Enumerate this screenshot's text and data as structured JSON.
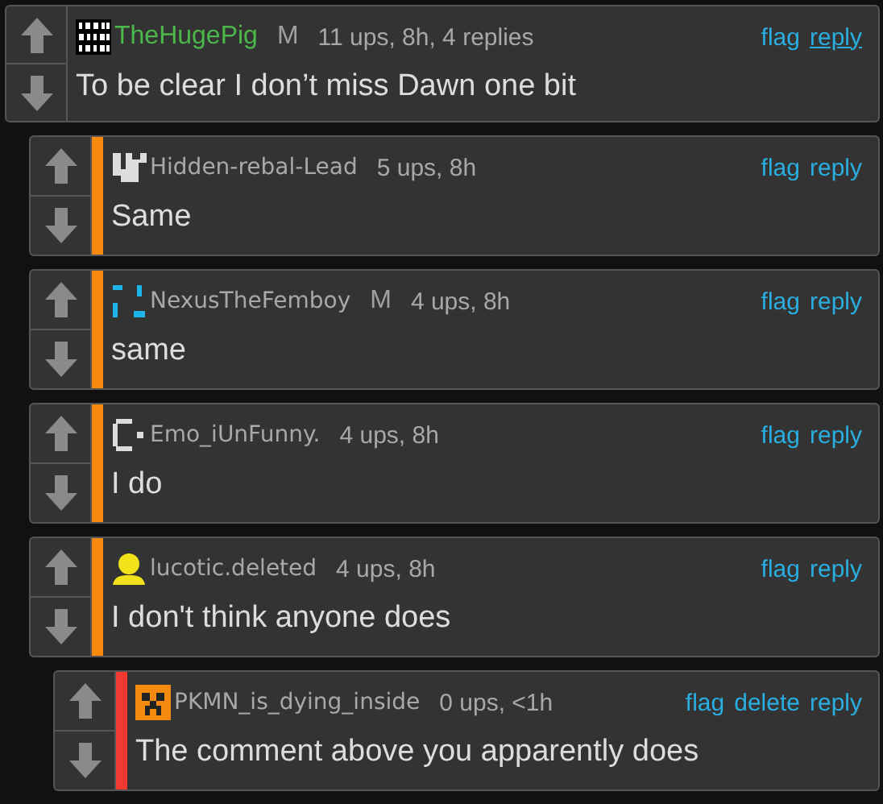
{
  "comments": [
    {
      "username": "TheHugePig",
      "name_highlighted": true,
      "badge": "M",
      "meta": "11 ups, 8h, 4 replies",
      "actions": [
        {
          "label": "flag",
          "underlined": false
        },
        {
          "label": "reply",
          "underlined": true
        }
      ],
      "text": "To be clear I don’t miss Dawn one bit",
      "children": [
        {
          "username": "Hidden-rebal-Lead",
          "name_highlighted": false,
          "color": "#f78a0e",
          "meta": "5 ups, 8h",
          "actions": [
            {
              "label": "flag",
              "underlined": false
            },
            {
              "label": "reply",
              "underlined": false
            }
          ],
          "text": "Same"
        },
        {
          "username": "NexusTheFemboy",
          "name_highlighted": false,
          "color": "#f78a0e",
          "badge": "M",
          "meta": "4 ups, 8h",
          "actions": [
            {
              "label": "flag",
              "underlined": false
            },
            {
              "label": "reply",
              "underlined": false
            }
          ],
          "text": "same"
        },
        {
          "username": "Emo_iUnFunny.",
          "name_highlighted": false,
          "color": "#f78a0e",
          "meta": "4 ups, 8h",
          "actions": [
            {
              "label": "flag",
              "underlined": false
            },
            {
              "label": "reply",
              "underlined": false
            }
          ],
          "text": "I do"
        },
        {
          "username": "lucotic.deleted",
          "name_highlighted": false,
          "color": "#f78a0e",
          "meta": "4 ups, 8h",
          "actions": [
            {
              "label": "flag",
              "underlined": false
            },
            {
              "label": "reply",
              "underlined": false
            }
          ],
          "text": "I don't think anyone does",
          "children": [
            {
              "username": "PKMN_is_dying_inside",
              "name_highlighted": false,
              "color": "#f23a32",
              "meta": "0 ups, <1h",
              "actions": [
                {
                  "label": "flag",
                  "underlined": false
                },
                {
                  "label": "delete",
                  "underlined": false
                },
                {
                  "label": "reply",
                  "underlined": false
                }
              ],
              "text": "The comment above you apparently does"
            }
          ]
        }
      ]
    }
  ]
}
